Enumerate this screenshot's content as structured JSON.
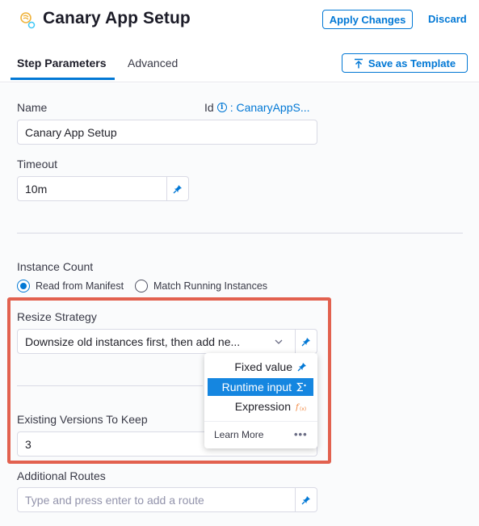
{
  "header": {
    "title": "Canary App Setup",
    "apply_label": "Apply Changes",
    "discard_label": "Discard"
  },
  "tabs": [
    {
      "label": "Step Parameters",
      "active": true
    },
    {
      "label": "Advanced",
      "active": false
    }
  ],
  "save_template_label": "Save as Template",
  "form": {
    "name_label": "Name",
    "id_label": "Id",
    "id_value": ": CanaryAppS...",
    "name_value": "Canary App Setup",
    "timeout_label": "Timeout",
    "timeout_value": "10m",
    "instance_count_label": "Instance Count",
    "instance_options": [
      {
        "label": "Read from Manifest",
        "selected": true
      },
      {
        "label": "Match Running Instances",
        "selected": false
      }
    ],
    "resize_label": "Resize Strategy",
    "resize_value": "Downsize old instances first, then add ne...",
    "versions_label": "Existing Versions To Keep",
    "versions_value": "3",
    "routes_label": "Additional Routes",
    "routes_placeholder": "Type and press enter to add a route"
  },
  "menu": {
    "items": [
      {
        "label": "Fixed value",
        "icon": "pin-icon",
        "selected": false
      },
      {
        "label": "Runtime input",
        "icon": "runtime-input-icon",
        "selected": true
      },
      {
        "label": "Expression",
        "icon": "expression-icon",
        "selected": false
      }
    ],
    "learn_more": "Learn More",
    "more": "•••"
  },
  "colors": {
    "accent": "#0278d5",
    "highlight": "#e2614f",
    "menu_selected": "#1586e0",
    "expression": "#f0843c"
  }
}
